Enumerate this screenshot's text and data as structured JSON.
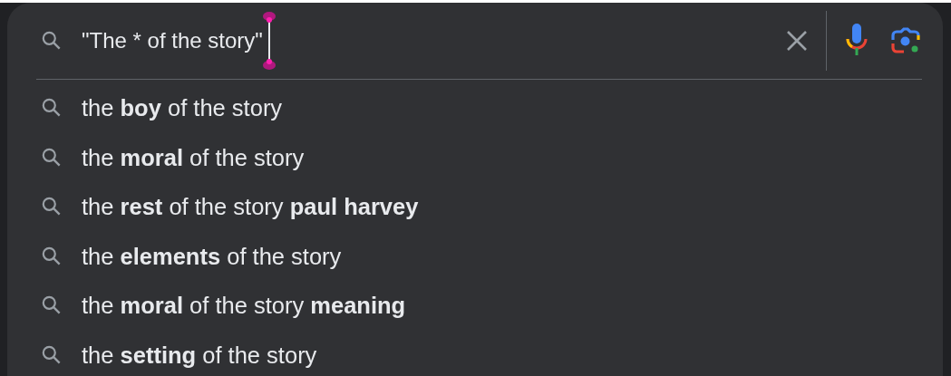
{
  "search": {
    "value": "\"The * of the story\""
  },
  "suggestions": [
    {
      "text": "the **boy** of the story"
    },
    {
      "text": "the **moral** of the story"
    },
    {
      "text": "the **rest** of the story **paul harvey**"
    },
    {
      "text": "the **elements** of the story"
    },
    {
      "text": "the **moral** of the story **meaning**"
    },
    {
      "text": "the **setting** of the story"
    }
  ]
}
